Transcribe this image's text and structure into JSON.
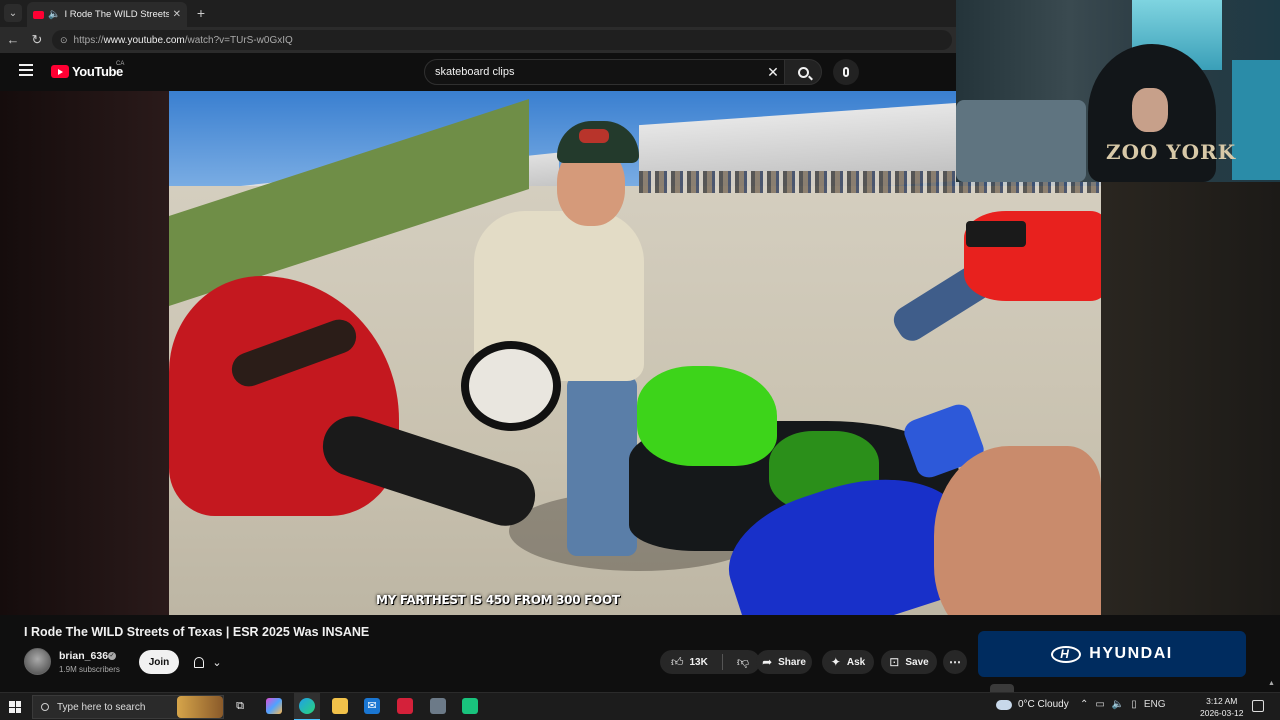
{
  "browser": {
    "tab_title": "I Rode The WILD Streets of Te",
    "url_prefix": "https://",
    "url_host": "www.youtube.com",
    "url_path": "/watch?v=TUrS-w0GxIQ"
  },
  "youtube": {
    "logo_text": "YouTube",
    "country_code": "CA",
    "search_query": "skateboard clips"
  },
  "video": {
    "subtitle": "MY FARTHEST IS 450 FROM 300 FOOT",
    "title": "I Rode The WILD Streets of Texas | ESR 2025 Was INSANE"
  },
  "webcam": {
    "shirt_print": "ZOO YORK"
  },
  "channel": {
    "name": "brian_636",
    "subscribers": "1.9M subscribers",
    "join_label": "Join"
  },
  "actions": {
    "likes": "13K",
    "share": "Share",
    "ask": "Ask",
    "save": "Save"
  },
  "ad": {
    "brand": "HYUNDAI"
  },
  "taskbar": {
    "search_placeholder": "Type here to search",
    "weather": "0°C  Cloudy",
    "language": "ENG",
    "time": "3:12 AM",
    "date": "2026-03-12"
  },
  "icons": [
    "tab-menu-icon",
    "speaker-icon",
    "close-icon",
    "plus-icon",
    "back-icon",
    "reload-icon",
    "lock-icon",
    "menu-icon",
    "search-icon",
    "mic-icon",
    "bell-icon",
    "chevron-down-icon",
    "thumb-up-icon",
    "thumb-down-icon",
    "share-icon",
    "sparkle-icon",
    "bookmark-icon",
    "more-icon",
    "windows-icon",
    "task-view-icon",
    "edge-icon",
    "explorer-icon",
    "mail-icon",
    "cloud-icon",
    "notification-icon"
  ],
  "colors": {
    "youtube_red": "#ff0033",
    "background": "#0f0f0f",
    "hyundai_blue": "#002c5f",
    "accent": "#4cc2ff"
  }
}
